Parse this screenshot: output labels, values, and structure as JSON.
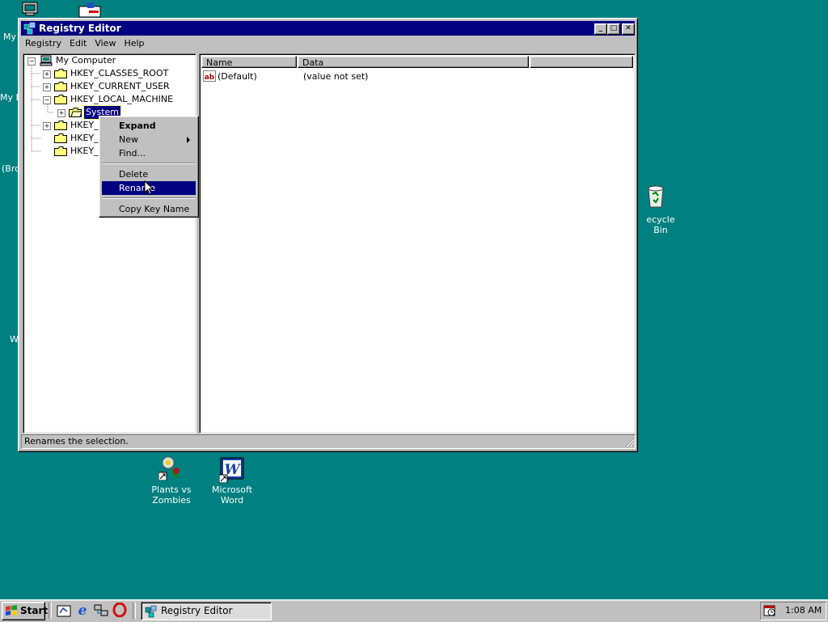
{
  "desktop": {
    "partial_labels": [
      "My",
      "My D",
      "(Bro",
      "W"
    ],
    "icons": [
      {
        "name": "plants-vs-zombies",
        "label_line1": "Plants vs",
        "label_line2": "Zombies",
        "icon": "plant-icon"
      },
      {
        "name": "microsoft-word",
        "label_line1": "Microsoft",
        "label_line2": "Word",
        "icon": "word-icon"
      },
      {
        "name": "recycle-bin",
        "label_line1": "ecycle Bin",
        "label_line2": "",
        "icon": "recycle-bin-icon"
      }
    ]
  },
  "window": {
    "title": "Registry Editor",
    "menu": [
      "Registry",
      "Edit",
      "View",
      "Help"
    ],
    "tree": {
      "root": "My Computer",
      "items": [
        "HKEY_CLASSES_ROOT",
        "HKEY_CURRENT_USER",
        "HKEY_LOCAL_MACHINE",
        "System",
        "HKEY_",
        "HKEY_",
        "HKEY_"
      ]
    },
    "list": {
      "columns": [
        "Name",
        "Data"
      ],
      "rows": [
        {
          "name": "(Default)",
          "data": "(value not set)"
        }
      ]
    },
    "status": "Renames the selection."
  },
  "context_menu": {
    "items": [
      "Expand",
      "New",
      "Find...",
      "Delete",
      "Rename",
      "Copy Key Name"
    ],
    "highlighted": "Rename"
  },
  "taskbar": {
    "start_label": "Start",
    "quick_launch": [
      "show-desktop-icon",
      "ie-icon",
      "network-icon",
      "opera-icon"
    ],
    "task_label": "Registry Editor",
    "clock": "1:08 AM"
  },
  "colors": {
    "desktop": "#008080",
    "titlebar": "#000080",
    "highlight": "#000080",
    "face": "#c0c0c0"
  }
}
